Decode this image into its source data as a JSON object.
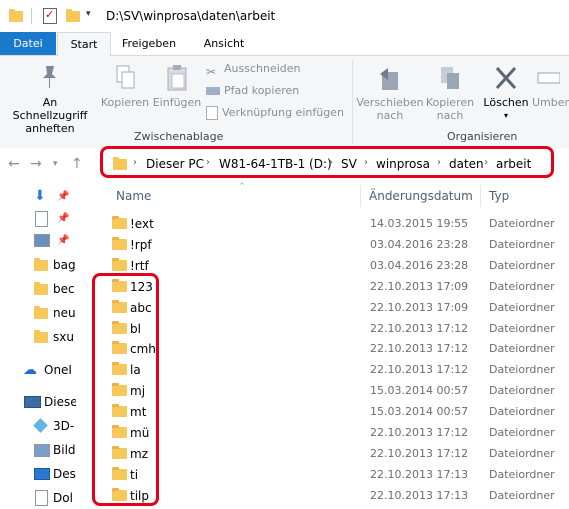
{
  "window": {
    "title": "D:\\SV\\winprosa\\daten\\arbeit"
  },
  "tabs": {
    "file": "Datei",
    "start": "Start",
    "share": "Freigeben",
    "view": "Ansicht"
  },
  "ribbon": {
    "pin_label_1": "An Schnellzugriff",
    "pin_label_2": "anheften",
    "copy": "Kopieren",
    "paste": "Einfügen",
    "cut": "Ausschneiden",
    "copy_path": "Pfad kopieren",
    "paste_shortcut": "Verknüpfung einfügen",
    "clipboard_group": "Zwischenablage",
    "move_1": "Verschieben",
    "move_2": "nach",
    "copyto_1": "Kopieren",
    "copyto_2": "nach",
    "delete": "Löschen",
    "rename_partial": "Umben",
    "organize_group": "Organisieren"
  },
  "address": {
    "crumbs": [
      "Dieser PC",
      "W81-64-1TB-1 (D:)",
      "SV",
      "winprosa",
      "daten",
      "arbeit"
    ]
  },
  "nav": {
    "items": [
      "bag",
      "bec",
      "neu",
      "sxu",
      "OneI",
      "Diese",
      "3D-",
      "Bild",
      "Des",
      "Dol"
    ]
  },
  "columns": {
    "name": "Name",
    "date": "Änderungsdatum",
    "type": "Typ"
  },
  "files": [
    {
      "name": "!ext",
      "date": "14.03.2015 19:55",
      "type": "Dateiordner"
    },
    {
      "name": "!rpf",
      "date": "03.04.2016 23:28",
      "type": "Dateiordner"
    },
    {
      "name": "!rtf",
      "date": "03.04.2016 23:28",
      "type": "Dateiordner"
    },
    {
      "name": "123",
      "date": "22.10.2013 17:09",
      "type": "Dateiordner"
    },
    {
      "name": "abc",
      "date": "22.10.2013 17:09",
      "type": "Dateiordner"
    },
    {
      "name": "bl",
      "date": "22.10.2013 17:12",
      "type": "Dateiordner"
    },
    {
      "name": "cmh",
      "date": "22.10.2013 17:12",
      "type": "Dateiordner"
    },
    {
      "name": "la",
      "date": "22.10.2013 17:12",
      "type": "Dateiordner"
    },
    {
      "name": "mj",
      "date": "15.03.2014 00:57",
      "type": "Dateiordner"
    },
    {
      "name": "mt",
      "date": "15.03.2014 00:57",
      "type": "Dateiordner"
    },
    {
      "name": "mü",
      "date": "22.10.2013 17:12",
      "type": "Dateiordner"
    },
    {
      "name": "mz",
      "date": "22.10.2013 17:12",
      "type": "Dateiordner"
    },
    {
      "name": "ti",
      "date": "22.10.2013 17:13",
      "type": "Dateiordner"
    },
    {
      "name": "tilp",
      "date": "22.10.2013 17:13",
      "type": "Dateiordner"
    }
  ],
  "colors": {
    "accent": "#1979ca",
    "highlight": "#e4001b",
    "folder": "#f6c75a"
  }
}
